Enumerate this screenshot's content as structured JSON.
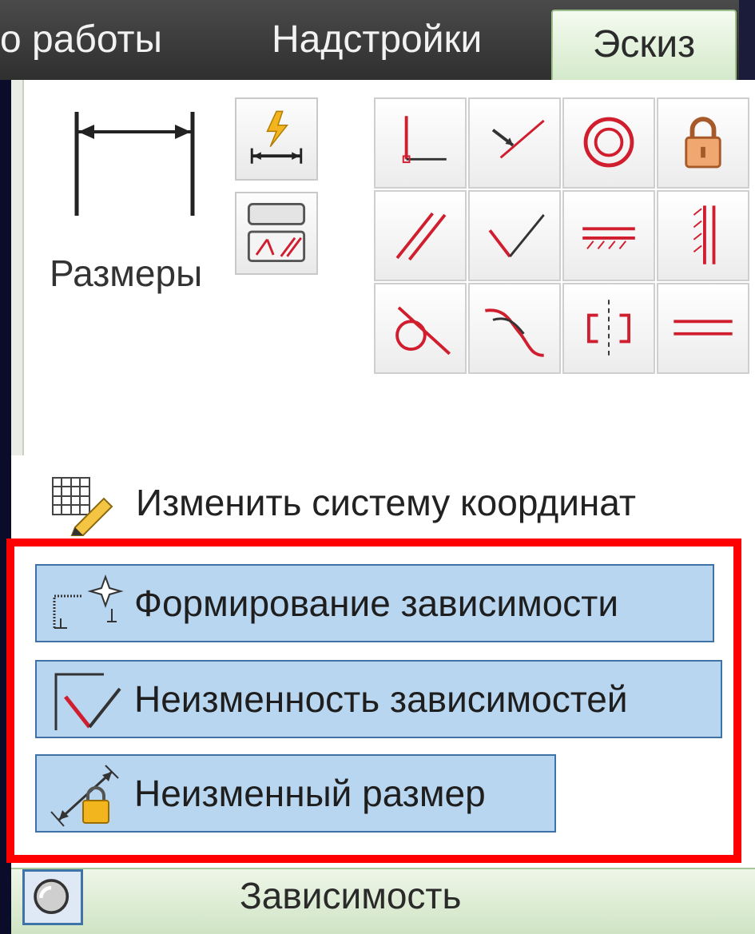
{
  "ribbon": {
    "tabs": [
      {
        "label": "о работы"
      },
      {
        "label": "Надстройки"
      },
      {
        "label": "Эскиз",
        "active": true
      }
    ]
  },
  "panel": {
    "dimension_label": "Размеры",
    "small_buttons": [
      {
        "icon": "auto-dimension-icon"
      },
      {
        "icon": "show-constraints-icon"
      }
    ],
    "constraint_grid": [
      {
        "icon": "perpendicular-icon"
      },
      {
        "icon": "coincident-icon"
      },
      {
        "icon": "concentric-icon"
      },
      {
        "icon": "fix-lock-icon"
      },
      {
        "icon": "parallel-icon"
      },
      {
        "icon": "perpendicular-angle-icon"
      },
      {
        "icon": "horizontal-icon"
      },
      {
        "icon": "vertical-icon"
      },
      {
        "icon": "tangent-icon"
      },
      {
        "icon": "smooth-icon"
      },
      {
        "icon": "symmetric-icon"
      },
      {
        "icon": "equal-icon"
      }
    ],
    "coordinate_system_label": "Изменить систему координат",
    "constraint_buttons": [
      {
        "label": "Формирование зависимости",
        "icon": "constraint-inference-icon"
      },
      {
        "label": "Неизменность зависимостей",
        "icon": "constraint-persistence-icon"
      },
      {
        "label": "Неизменный размер",
        "icon": "driven-dimension-lock-icon"
      }
    ],
    "group_label": "Зависимость"
  },
  "colors": {
    "highlight": "#ff0000",
    "active_tab": "#d2e8c8",
    "button_fill": "#b9d6f0",
    "icon_red": "#d01e2e"
  }
}
